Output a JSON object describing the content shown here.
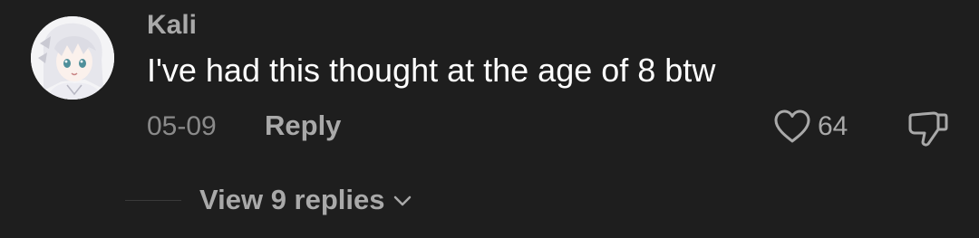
{
  "comment": {
    "username": "Kali",
    "text": "I've had this thought at the age of 8 btw",
    "date": "05-09",
    "reply_label": "Reply",
    "like_count": "64",
    "avatar_icon": "anime-girl-avatar",
    "like_icon": "heart-outline-icon",
    "dislike_icon": "thumbs-down-outline-icon"
  },
  "replies": {
    "label": "View 9 replies",
    "icon": "chevron-down-icon"
  },
  "colors": {
    "background": "#1e1e1e",
    "text_primary": "#ffffff",
    "text_secondary": "#a9a9a9",
    "text_muted": "#8a8a8a"
  }
}
